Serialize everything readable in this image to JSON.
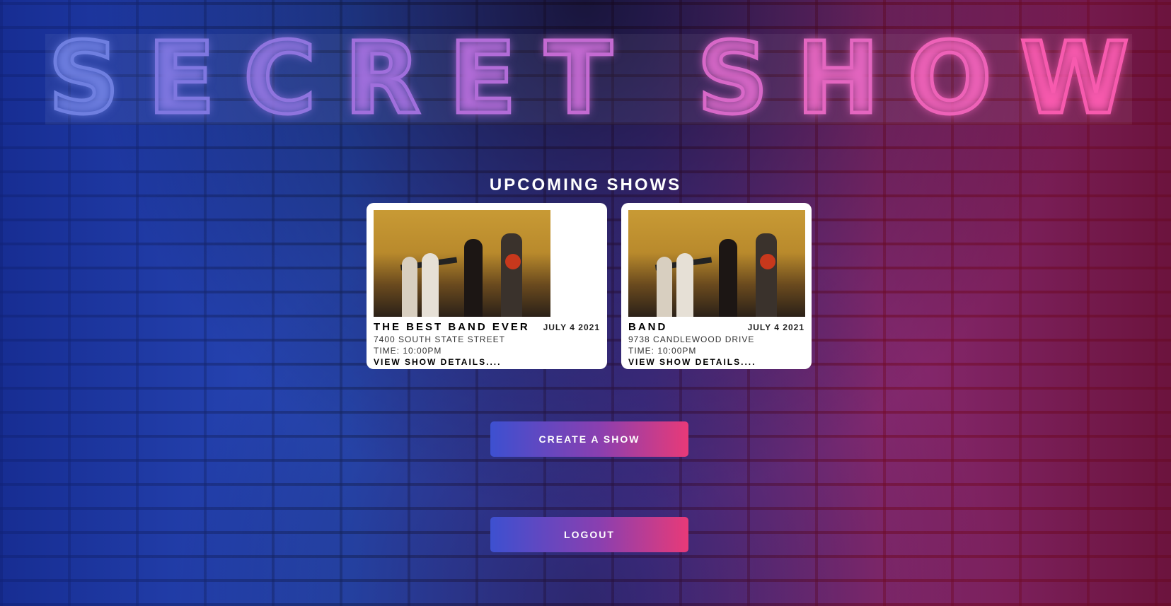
{
  "header": {
    "title_letters": [
      "S",
      "E",
      "C",
      "R",
      "E",
      "T",
      " ",
      "S",
      "H",
      "O",
      "W"
    ],
    "title_colors": [
      "#6f7fe0",
      "#7f77e0",
      "#8f74de",
      "#a06fdc",
      "#b26cd8",
      "#c46ad2",
      "",
      "#d868c8",
      "#e466c0",
      "#ee62b8",
      "#f75aae"
    ]
  },
  "shows": {
    "heading": "UPCOMING SHOWS",
    "cards": [
      {
        "name": "THE BEST BAND EVER",
        "date": "JULY 4 2021",
        "address": "7400 SOUTH STATE STREET",
        "time": "TIME: 10:00PM",
        "link": "VIEW SHOW DETAILS...."
      },
      {
        "name": "BAND",
        "date": "JULY 4 2021",
        "address": "9738 CANDLEWOOD DRIVE",
        "time": "TIME: 10:00PM",
        "link": "VIEW SHOW DETAILS...."
      }
    ]
  },
  "actions": {
    "create_label": "CREATE A SHOW",
    "logout_label": "LOGOUT"
  }
}
